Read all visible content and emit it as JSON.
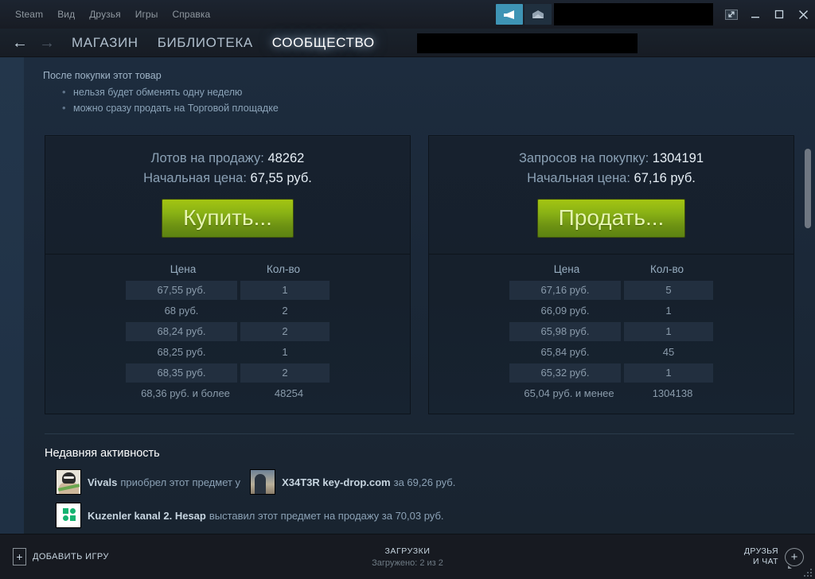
{
  "window": {
    "menu": [
      "Steam",
      "Вид",
      "Друзья",
      "Игры",
      "Справка"
    ],
    "icons": {
      "broadcast": "broadcast-icon",
      "mail": "mail-icon",
      "restore_external": "external-window-icon",
      "minimize": "minimize-icon",
      "maximize": "maximize-icon",
      "close": "close-icon"
    },
    "account_redacted": "",
    "colors": {
      "accent_button": "#3e94b5",
      "market_green": "#8ab215",
      "page_bg": "#1b2838",
      "chrome_bg": "#171a21"
    }
  },
  "nav": {
    "back": "←",
    "forward": "→",
    "tabs": [
      {
        "label": "МАГАЗИН",
        "active": false
      },
      {
        "label": "БИБЛИОТЕКА",
        "active": false
      },
      {
        "label": "СООБЩЕСТВО",
        "active": true
      }
    ],
    "search_redacted": ""
  },
  "notice": {
    "title": "После покупки этот товар",
    "bullets": [
      "нельзя будет обменять одну неделю",
      "можно сразу продать на Торговой площадке"
    ]
  },
  "market": {
    "buy_panel": {
      "stat_label": "Лотов на продажу:",
      "stat_value": "48262",
      "price_label": "Начальная цена:",
      "price_value": "67,55 руб.",
      "button": "Купить...",
      "table": {
        "headers": [
          "Цена",
          "Кол-во"
        ],
        "rows": [
          {
            "price": "67,55 руб.",
            "qty": "1"
          },
          {
            "price": "68 руб.",
            "qty": "2"
          },
          {
            "price": "68,24 руб.",
            "qty": "2"
          },
          {
            "price": "68,25 руб.",
            "qty": "1"
          },
          {
            "price": "68,35 руб.",
            "qty": "2"
          }
        ],
        "total": {
          "price": "68,36 руб. и более",
          "qty": "48254"
        }
      }
    },
    "sell_panel": {
      "stat_label": "Запросов на покупку:",
      "stat_value": "1304191",
      "price_label": "Начальная цена:",
      "price_value": "67,16 руб.",
      "button": "Продать...",
      "table": {
        "headers": [
          "Цена",
          "Кол-во"
        ],
        "rows": [
          {
            "price": "67,16 руб.",
            "qty": "5"
          },
          {
            "price": "66,09 руб.",
            "qty": "1"
          },
          {
            "price": "65,98 руб.",
            "qty": "1"
          },
          {
            "price": "65,84 руб.",
            "qty": "45"
          },
          {
            "price": "65,32 руб.",
            "qty": "1"
          }
        ],
        "total": {
          "price": "65,04 руб. и менее",
          "qty": "1304138"
        }
      }
    }
  },
  "activity": {
    "title": "Недавняя активность",
    "entries": [
      {
        "actor": "Vivals",
        "mid_text": "приобрел этот предмет у",
        "counterparty": "X34T3R key-drop.com",
        "tail_text": "за 69,26 руб.",
        "actor_avatar": "bandit-avatar",
        "counterparty_avatar": "sky-portrait-avatar"
      },
      {
        "actor": "Kuzenler kanal 2. Hesap",
        "mid_text": "выставил этот предмет на продажу за 70,03 руб.",
        "counterparty": "",
        "tail_text": "",
        "actor_avatar": "green-blocks-logo-avatar",
        "counterparty_avatar": ""
      }
    ]
  },
  "footer": {
    "add_game": "ДОБАВИТЬ ИГРУ",
    "add_game_plus": "+",
    "downloads_title": "ЗАГРУЗКИ",
    "downloads_status": "Загружено: 2 из 2",
    "friends_line1": "ДРУЗЬЯ",
    "friends_line2": "И ЧАТ",
    "friends_plus": "+"
  }
}
